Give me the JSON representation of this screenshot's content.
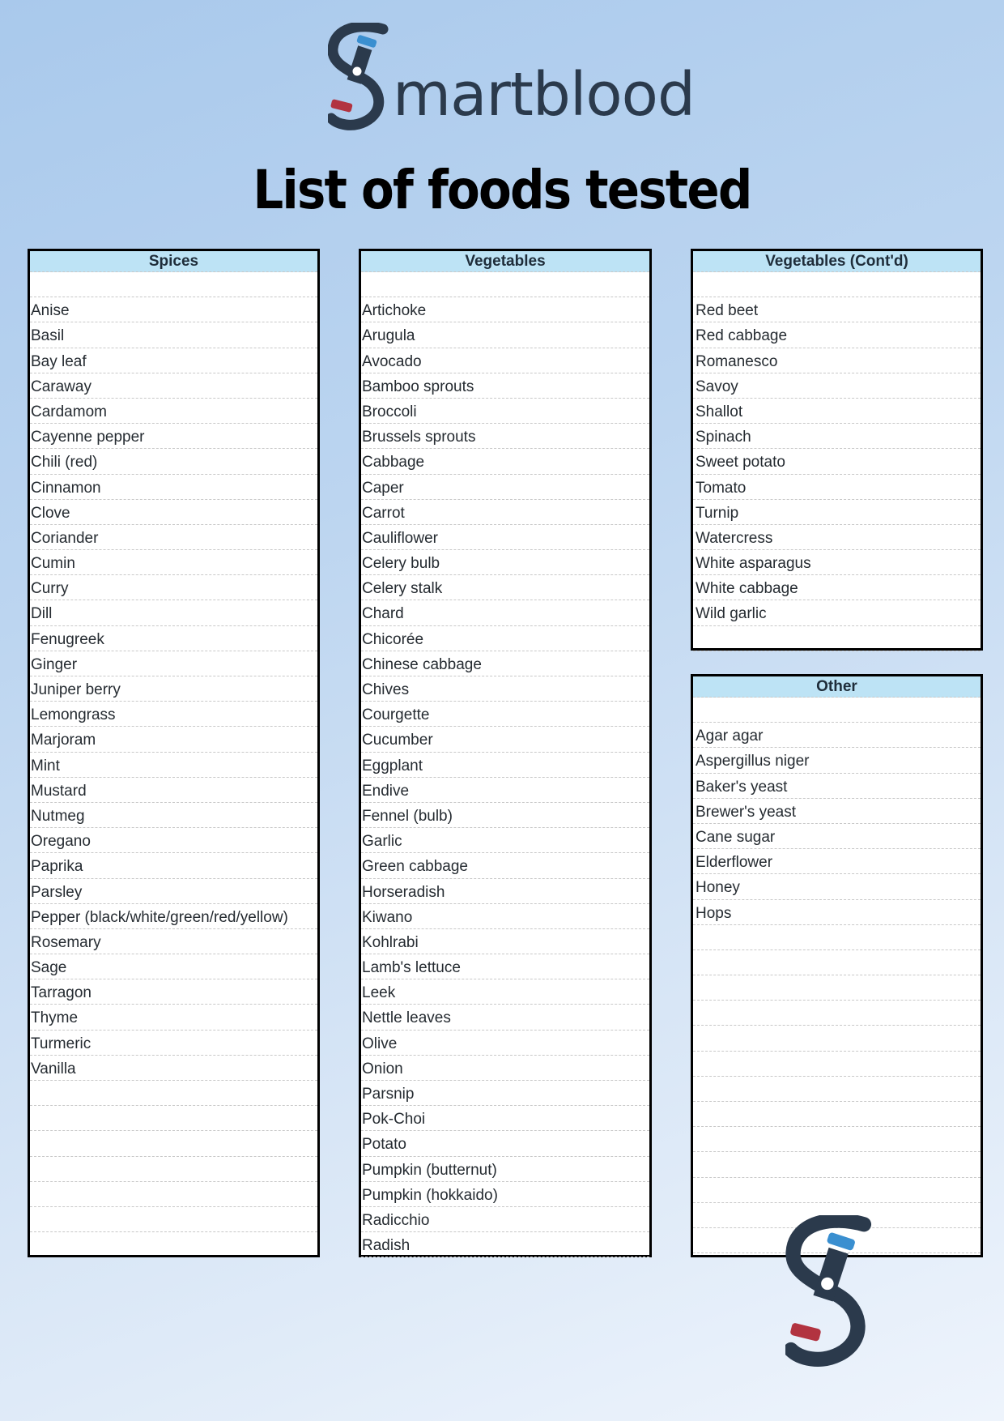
{
  "brand": {
    "name_rest": "martblood",
    "colors": {
      "dark": "#2b3a4c",
      "blue": "#3a8fd0",
      "red": "#b23340"
    }
  },
  "title": "List of foods tested",
  "sections": {
    "spices": {
      "heading": "Spices",
      "items": [
        "Anise",
        "Basil",
        "Bay leaf",
        "Caraway",
        "Cardamom",
        "Cayenne pepper",
        "Chili (red)",
        "Cinnamon",
        "Clove",
        "Coriander",
        "Cumin",
        "Curry",
        "Dill",
        "Fenugreek",
        "Ginger",
        "Juniper berry",
        "Lemongrass",
        "Marjoram",
        "Mint",
        "Mustard",
        "Nutmeg",
        "Oregano",
        "Paprika",
        "Parsley",
        "Pepper (black/white/green/red/yellow)",
        "Rosemary",
        "Sage",
        "Tarragon",
        "Thyme",
        "Turmeric",
        "Vanilla"
      ]
    },
    "vegetables": {
      "heading": "Vegetables",
      "items": [
        "Artichoke",
        "Arugula",
        "Avocado",
        "Bamboo sprouts",
        "Broccoli",
        "Brussels sprouts",
        "Cabbage",
        "Caper",
        "Carrot",
        "Cauliflower",
        "Celery bulb",
        "Celery stalk",
        "Chard",
        "Chicorée",
        "Chinese cabbage",
        "Chives",
        "Courgette",
        "Cucumber",
        "Eggplant",
        "Endive",
        "Fennel (bulb)",
        "Garlic",
        "Green cabbage",
        "Horseradish",
        "Kiwano",
        "Kohlrabi",
        "Lamb's lettuce",
        "Leek",
        "Nettle leaves",
        "Olive",
        "Onion",
        "Parsnip",
        "Pok-Choi",
        "Potato",
        "Pumpkin (butternut)",
        "Pumpkin (hokkaido)",
        "Radicchio",
        "Radish"
      ]
    },
    "vegetables_contd": {
      "heading": "Vegetables (Cont'd)",
      "items": [
        "Red beet",
        "Red cabbage",
        "Romanesco",
        "Savoy",
        "Shallot",
        "Spinach",
        "Sweet potato",
        "Tomato",
        "Turnip",
        "Watercress",
        "White asparagus",
        "White cabbage",
        "Wild garlic"
      ]
    },
    "other": {
      "heading": "Other",
      "items": [
        "Agar agar",
        "Aspergillus niger",
        "Baker's yeast",
        "Brewer's yeast",
        "Cane sugar",
        "Elderflower",
        "Honey",
        "Hops"
      ]
    }
  }
}
